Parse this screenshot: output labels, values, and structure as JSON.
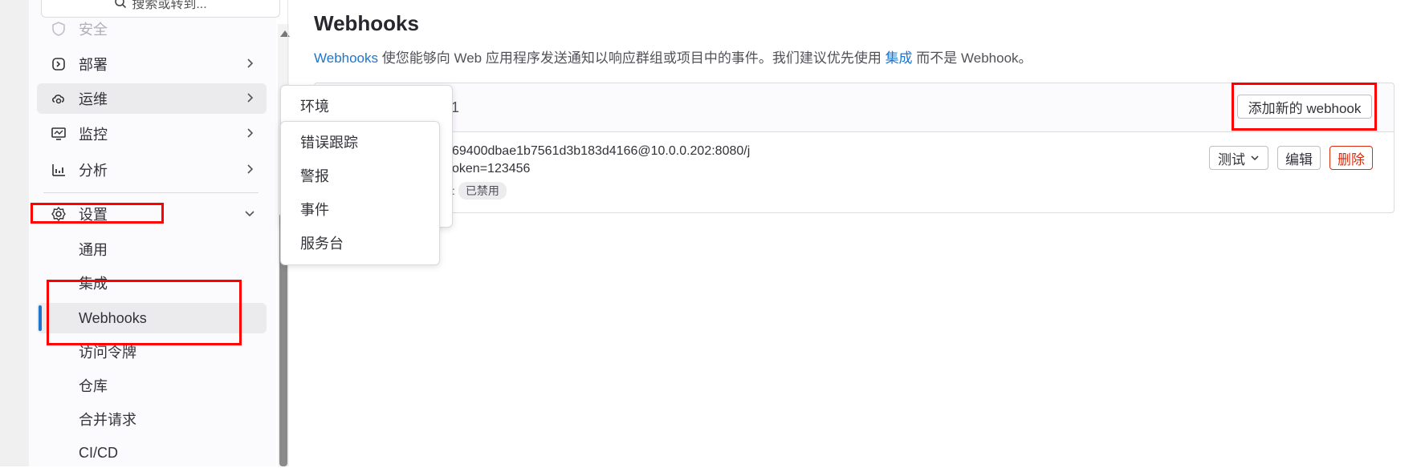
{
  "sidebar": {
    "search_placeholder": "搜索或转到...",
    "nav_items": [
      {
        "label": "安全",
        "icon": "shield-icon"
      },
      {
        "label": "部署",
        "icon": "deploy-icon"
      },
      {
        "label": "运维",
        "icon": "cloud-gear-icon"
      },
      {
        "label": "监控",
        "icon": "monitor-icon"
      },
      {
        "label": "分析",
        "icon": "chart-icon"
      },
      {
        "label": "设置",
        "icon": "gear-icon"
      }
    ],
    "settings_sub_items": [
      "通用",
      "集成",
      "Webhooks",
      "访问令牌",
      "仓库",
      "合并请求",
      "CI/CD"
    ]
  },
  "flyout": {
    "header_item": "环境",
    "items": [
      "错误跟踪",
      "警报",
      "事件",
      "服务台"
    ]
  },
  "main": {
    "title": "Webhooks",
    "description": {
      "link_webhooks": "Webhooks",
      "text_middle": " 使您能够向 Web 应用程序发送通知以响应群组或项目中的事件。我们建议优先使用 ",
      "link_integrations": "集成",
      "text_end": " 而不是 Webhook。"
    },
    "card": {
      "count": "1",
      "add_button": "添加新的 webhook",
      "hook": {
        "url_visible": "69400dbae1b7561d3b183d4166@10.0.0.202:8080/j",
        "token_visible": "oken=123456",
        "status_prefix": ":",
        "status_badge": "已禁用"
      },
      "test_button": "测试",
      "edit_button": "编辑",
      "delete_button": "删除"
    }
  },
  "colors": {
    "link": "#1f75cb",
    "danger": "#dd2b0e",
    "annotation": "#ff0000",
    "active_bg": "#ebebee"
  }
}
